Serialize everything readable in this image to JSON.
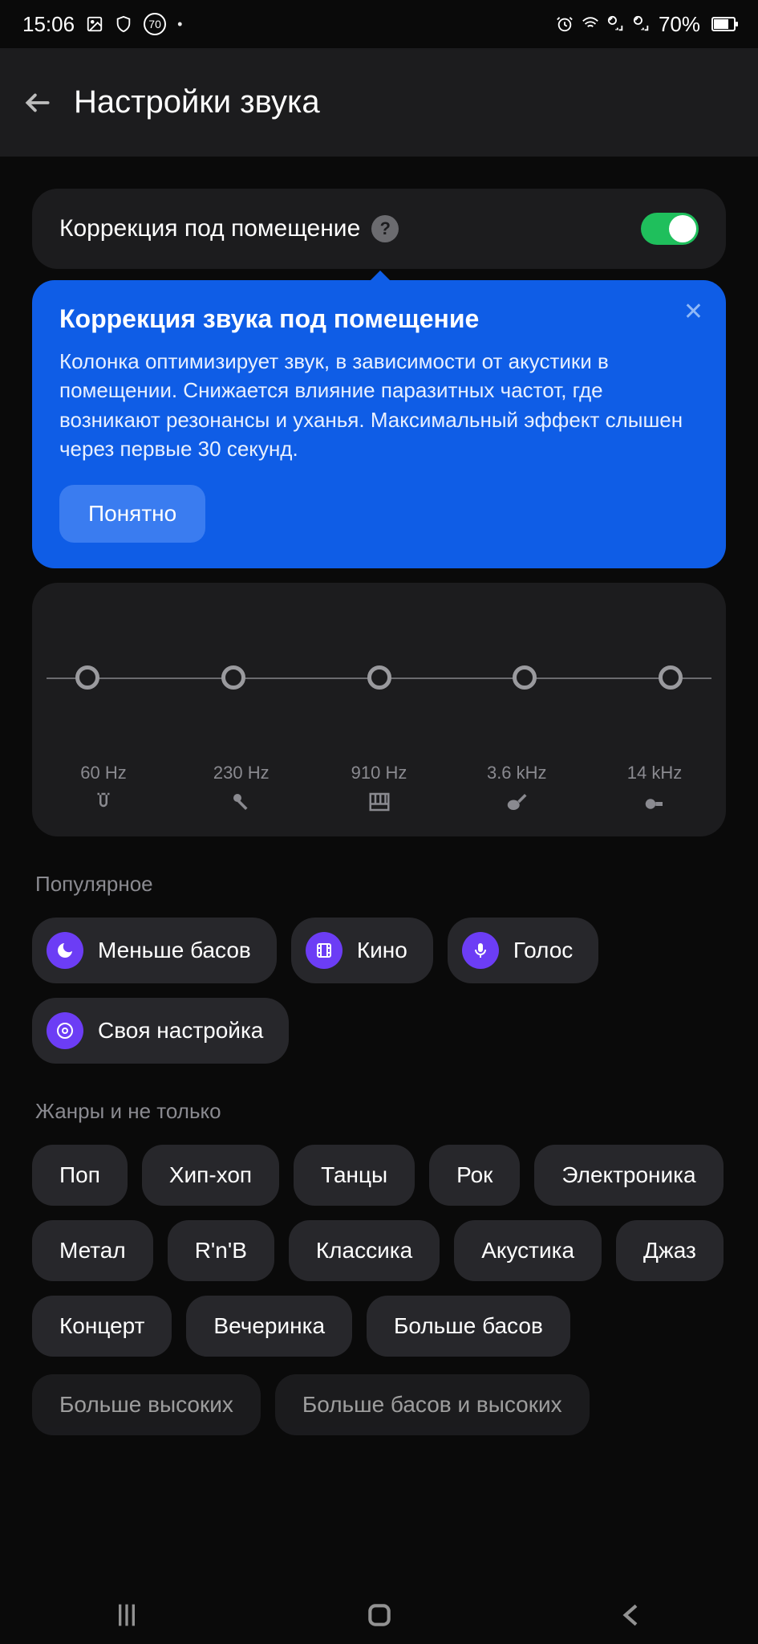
{
  "status": {
    "time": "15:06",
    "battery_pct": "70%",
    "badge": "70"
  },
  "header": {
    "title": "Настройки звука"
  },
  "room_correction": {
    "label": "Коррекция под помещение"
  },
  "tooltip": {
    "title": "Коррекция звука под помещение",
    "body": "Колонка оптимизирует звук, в зависимости от акустики в помещении. Снижается влияние паразитных частот, где возникают резонансы и уханья. Максимальный эффект слышен через первые 30 секунд.",
    "ok": "Понятно"
  },
  "eq": {
    "bands": [
      {
        "freq": "60 Hz"
      },
      {
        "freq": "230 Hz"
      },
      {
        "freq": "910 Hz"
      },
      {
        "freq": "3.6 kHz"
      },
      {
        "freq": "14 kHz"
      }
    ]
  },
  "popular": {
    "title": "Популярное",
    "items": [
      "Меньше басов",
      "Кино",
      "Голос",
      "Своя настройка"
    ]
  },
  "genres": {
    "title": "Жанры и не только",
    "items": [
      "Поп",
      "Хип-хоп",
      "Танцы",
      "Рок",
      "Электроника",
      "Метал",
      "R'n'B",
      "Классика",
      "Акустика",
      "Джаз",
      "Концерт",
      "Вечеринка",
      "Больше басов"
    ]
  },
  "bottom": {
    "left": "Больше высоких",
    "right": "Больше басов и высоких"
  }
}
